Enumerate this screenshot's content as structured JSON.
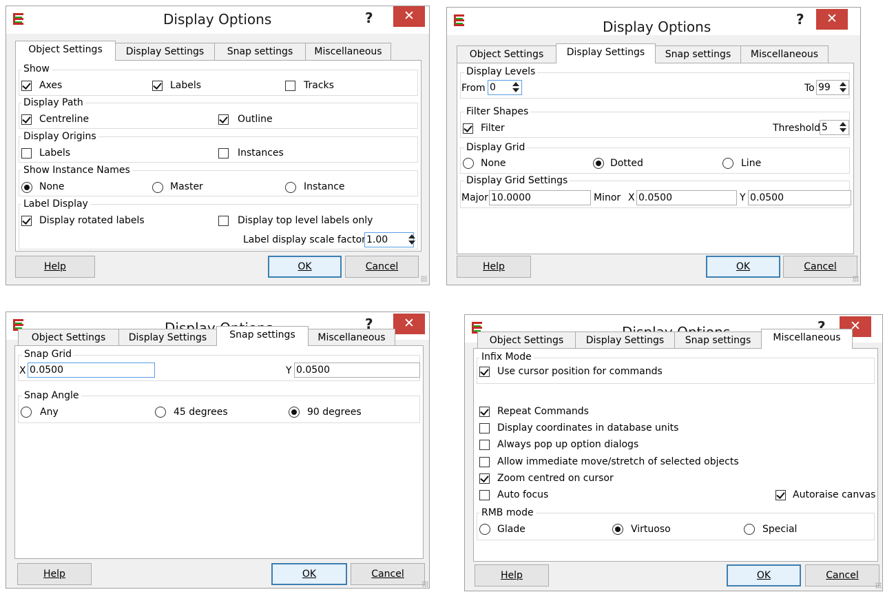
{
  "dialogs": [
    {
      "title": "Display Options",
      "help_glyph": "?",
      "close_glyph": "✕",
      "tabs": [
        "Object Settings",
        "Display Settings",
        "Snap settings",
        "Miscellaneous"
      ],
      "active_tab": "Object Settings",
      "groups": {
        "show": {
          "title": "Show",
          "axes": "Axes",
          "labels": "Labels",
          "tracks": "Tracks"
        },
        "display_path": {
          "title": "Display Path",
          "centreline": "Centreline",
          "outline": "Outline"
        },
        "display_origins": {
          "title": "Display Origins",
          "labels": "Labels",
          "instances": "Instances"
        },
        "show_instance_names": {
          "title": "Show Instance Names",
          "none": "None",
          "master": "Master",
          "instance": "Instance"
        },
        "label_display": {
          "title": "Label Display",
          "rotated": "Display rotated labels",
          "top_level": "Display top level labels only",
          "scale_label": "Label display scale factor",
          "scale_value": "1.00"
        }
      },
      "buttons": {
        "help": "Help",
        "ok": "OK",
        "cancel": "Cancel"
      }
    },
    {
      "title": "Display Options",
      "help_glyph": "?",
      "close_glyph": "✕",
      "tabs": [
        "Object Settings",
        "Display Settings",
        "Snap settings",
        "Miscellaneous"
      ],
      "active_tab": "Display Settings",
      "groups": {
        "display_levels": {
          "title": "Display Levels",
          "from_label": "From",
          "from_value": "0",
          "to_label": "To",
          "to_value": "99"
        },
        "filter_shapes": {
          "title": "Filter Shapes",
          "filter": "Filter",
          "threshold_label": "Threshold",
          "threshold_value": "5"
        },
        "display_grid": {
          "title": "Display Grid",
          "none": "None",
          "dotted": "Dotted",
          "line": "Line"
        },
        "grid_settings": {
          "title": "Display Grid Settings",
          "major_label": "Major",
          "major_value": "10.0000",
          "minor_label": "Minor",
          "x_label": "X",
          "x_value": "0.0500",
          "y_label": "Y",
          "y_value": "0.0500"
        }
      },
      "buttons": {
        "help": "Help",
        "ok": "OK",
        "cancel": "Cancel"
      }
    },
    {
      "title": "Display Options",
      "help_glyph": "?",
      "close_glyph": "✕",
      "tabs": [
        "Object Settings",
        "Display Settings",
        "Snap settings",
        "Miscellaneous"
      ],
      "active_tab": "Snap settings",
      "groups": {
        "snap_grid": {
          "title": "Snap Grid",
          "x_label": "X",
          "x_value": "0.0500",
          "y_label": "Y",
          "y_value": "0.0500"
        },
        "snap_angle": {
          "title": "Snap Angle",
          "any": "Any",
          "deg45": "45 degrees",
          "deg90": "90 degrees"
        }
      },
      "buttons": {
        "help": "Help",
        "ok": "OK",
        "cancel": "Cancel"
      }
    },
    {
      "title": "Display Options",
      "help_glyph": "?",
      "close_glyph": "✕",
      "tabs": [
        "Object Settings",
        "Display Settings",
        "Snap settings",
        "Miscellaneous"
      ],
      "active_tab": "Miscellaneous",
      "groups": {
        "infix_mode": {
          "title": "Infix Mode",
          "use_cursor": "Use cursor position for commands"
        },
        "options": {
          "repeat": "Repeat Commands",
          "db_units": "Display coordinates in database units",
          "popup": "Always pop up option dialogs",
          "immediate": "Allow immediate move/stretch of selected objects",
          "zoom": "Zoom centred on cursor",
          "autofocus": "Auto focus",
          "autoraise": "Autoraise canvas"
        },
        "rmb_mode": {
          "title": "RMB mode",
          "glade": "Glade",
          "virtuoso": "Virtuoso",
          "special": "Special"
        }
      },
      "buttons": {
        "help": "Help",
        "ok": "OK",
        "cancel": "Cancel"
      }
    }
  ],
  "colors": {
    "close": "#c7433b",
    "focus": "#569de5",
    "default_button": "#3c7fb1"
  }
}
